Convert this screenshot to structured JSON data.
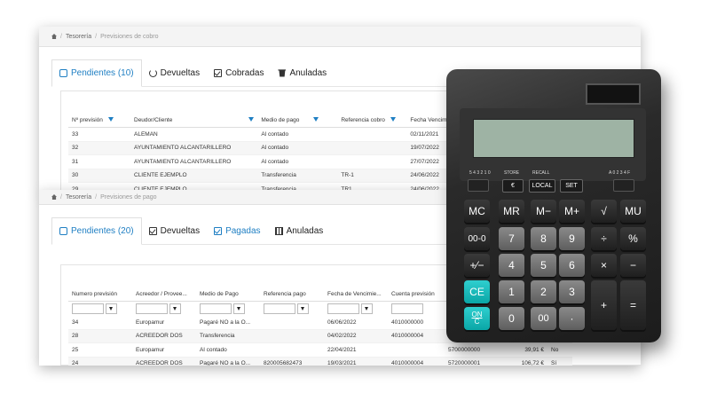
{
  "sheet1": {
    "breadcrumb": [
      "Tesorería",
      "Previsiones de cobro"
    ],
    "tabs": [
      {
        "label": "Pendientes (10)",
        "icon": "square-icon"
      },
      {
        "label": "Devueltas",
        "icon": "undo-icon"
      },
      {
        "label": "Cobradas",
        "icon": "check-square-icon"
      },
      {
        "label": "Anuladas",
        "icon": "trash-icon"
      }
    ],
    "columns": [
      "Nº previsión",
      "Deudor/Cliente",
      "Medio de pago",
      "Referencia cobro",
      "Fecha Vencimie"
    ],
    "rows": [
      [
        "33",
        "ALEMAN",
        "Al contado",
        "",
        "02/11/2021"
      ],
      [
        "32",
        "AYUNTAMIENTO ALCANTARILLERO",
        "Al contado",
        "",
        "19/07/2022"
      ],
      [
        "31",
        "AYUNTAMIENTO ALCANTARILLERO",
        "Al contado",
        "",
        "27/07/2022"
      ],
      [
        "30",
        "CLIENTE EJEMPLO",
        "Transferencia",
        "TR-1",
        "24/06/2022"
      ],
      [
        "29",
        "CLIENTE EJEMPLO",
        "Transferencia",
        "TR1",
        "24/06/2022"
      ]
    ]
  },
  "sheet2": {
    "breadcrumb": [
      "Tesorería",
      "Previsiones de pago"
    ],
    "tabs": [
      {
        "label": "Pendientes (20)",
        "icon": "square-icon"
      },
      {
        "label": "Devueltas",
        "icon": "check-square-icon"
      },
      {
        "label": "Pagadas",
        "icon": "check-square-icon"
      },
      {
        "label": "Anuladas",
        "icon": "grid-icon"
      }
    ],
    "columns": [
      "Numero previsión",
      "Acreedor / Provee...",
      "Medio de Pago",
      "Referencia pago",
      "Fecha de Vencimie...",
      "Cuenta previsión",
      "",
      "",
      ""
    ],
    "rows": [
      [
        "34",
        "Europamur",
        "Pagaré NO a la O...",
        "",
        "06/06/2022",
        "4010000000",
        "",
        "",
        ""
      ],
      [
        "28",
        "ACREEDOR DOS",
        "Transferencia",
        "",
        "04/02/2022",
        "4010000004",
        "",
        "",
        ""
      ],
      [
        "25",
        "Europamur",
        "Al contado",
        "",
        "22/04/2021",
        "",
        "5700000000",
        "39,91 €",
        "No"
      ],
      [
        "24",
        "ACREEDOR DOS",
        "Pagaré NO a la O...",
        "820005682473",
        "19/03/2021",
        "4010000004",
        "5720000001",
        "106,72 €",
        "Sí"
      ]
    ]
  },
  "calculator": {
    "top_labels": {
      "store": "STORE",
      "recall": "RECALL",
      "left_switch": "5 4 3 2 1 0",
      "right_switch": "A 0 2 3 4 F"
    },
    "top_keys": [
      "€",
      "LOCAL",
      "SET"
    ],
    "keys": {
      "r1": [
        "MC",
        "MR",
        "M−",
        "M+",
        "√",
        "MU"
      ],
      "r2": [
        "00-0",
        "7",
        "8",
        "9",
        "÷",
        "%"
      ],
      "r3": [
        "+⁄−",
        "4",
        "5",
        "6",
        "×",
        "−"
      ],
      "r4": [
        "CE",
        "1",
        "2",
        "3"
      ],
      "r5": [
        "0",
        "00",
        "·"
      ],
      "onc_top": "ON",
      "onc_bottom": "C",
      "plus": "+",
      "equals": "="
    }
  }
}
